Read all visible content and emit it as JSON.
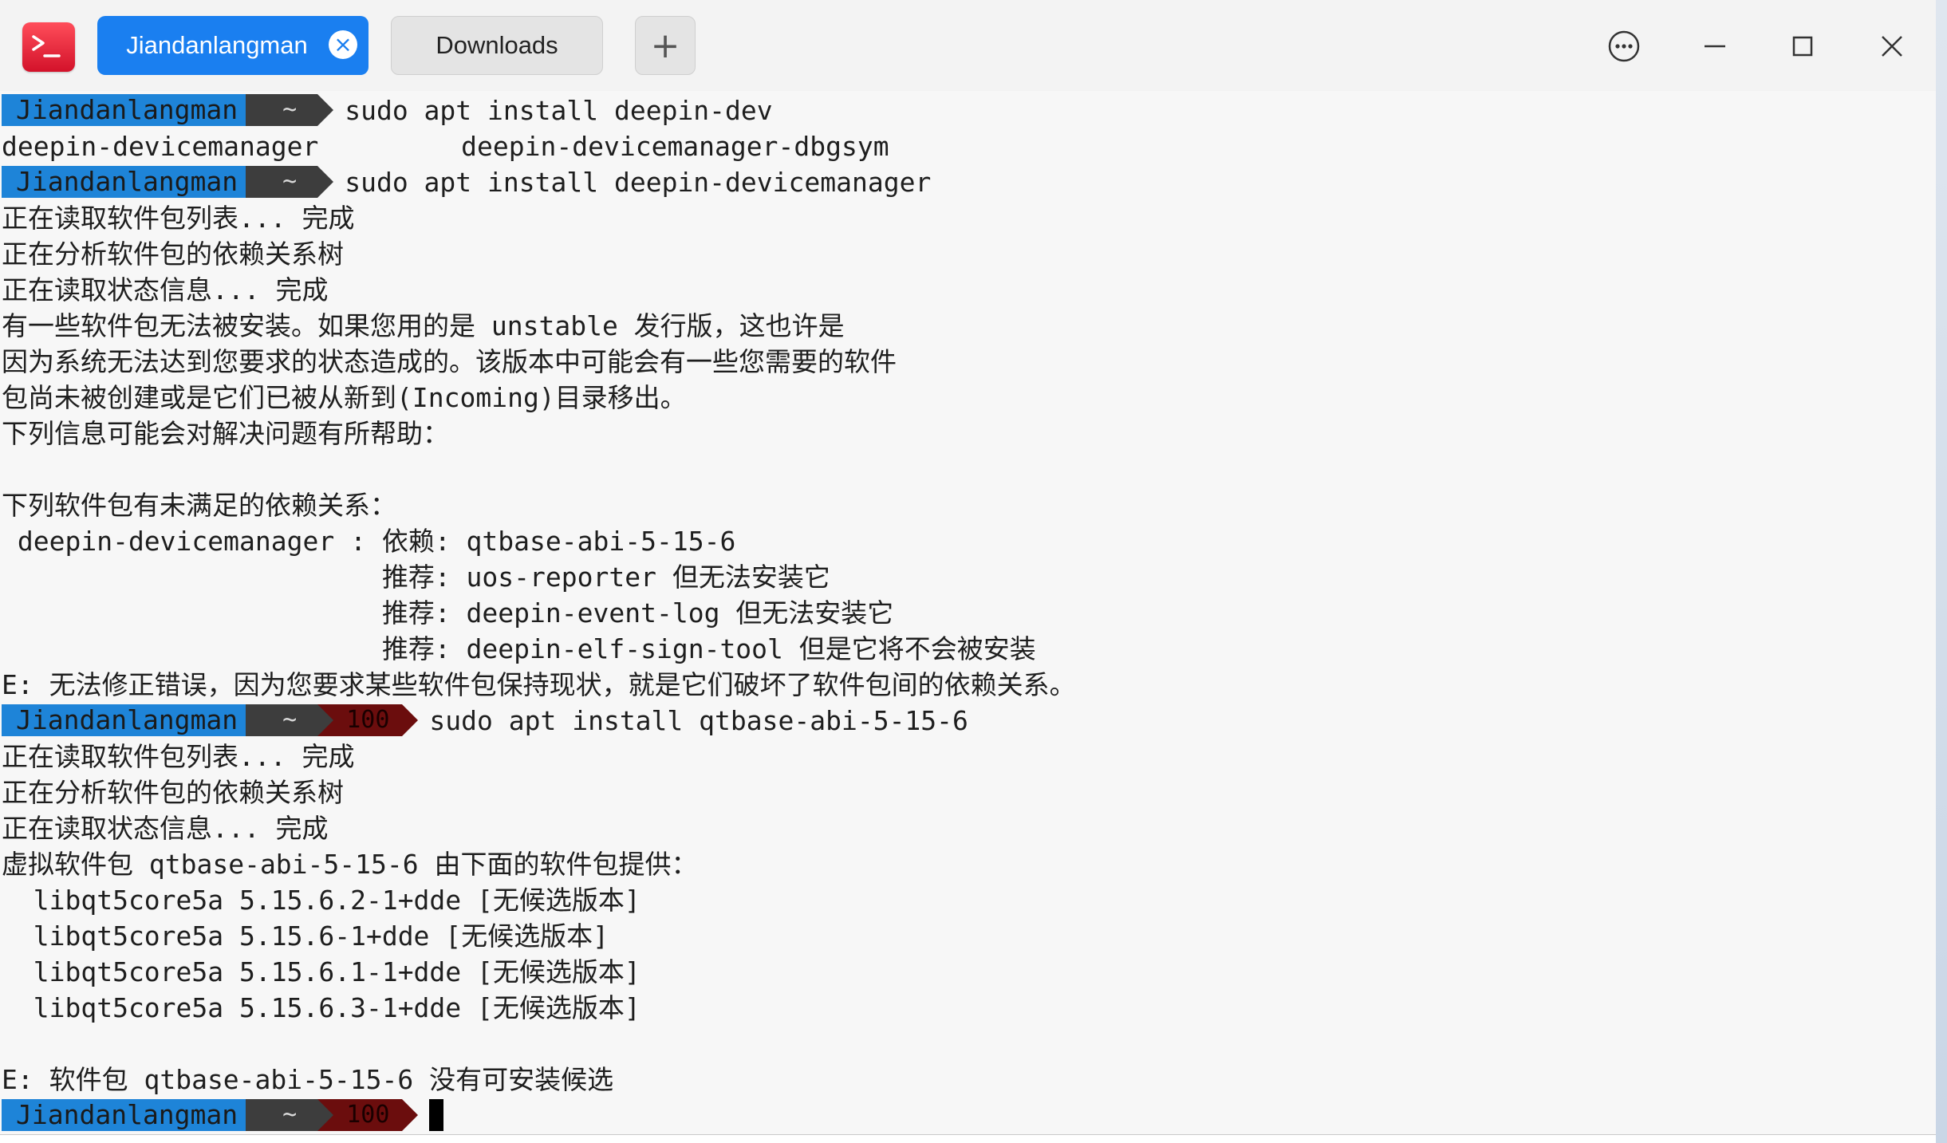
{
  "tabs": [
    {
      "label": "Jiandanlangman",
      "active": true
    },
    {
      "label": "Downloads",
      "active": false
    }
  ],
  "tab_add_label": "+",
  "tab_close_glyph": "×",
  "window_controls": [
    "more-icon",
    "minimize-icon",
    "maximize-icon",
    "close-icon"
  ],
  "colors": {
    "accent": "#1a7ff0",
    "prompt_user_bg": "#1e84d8",
    "prompt_home_bg": "#3d3d3d",
    "prompt_code_bg": "#6b0d0d",
    "app_icon": "#e8202f"
  },
  "prompt": {
    "user": "Jiandanlangman",
    "home": "~",
    "error_code": "100"
  },
  "lines": [
    {
      "type": "prompt",
      "cmd": "sudo apt install deepin-dev",
      "code": false
    },
    {
      "type": "text",
      "text": "deepin-devicemanager         deepin-devicemanager-dbgsym"
    },
    {
      "type": "prompt",
      "cmd": "sudo apt install deepin-devicemanager",
      "code": false
    },
    {
      "type": "text",
      "text": "正在读取软件包列表... 完成"
    },
    {
      "type": "text",
      "text": "正在分析软件包的依赖关系树"
    },
    {
      "type": "text",
      "text": "正在读取状态信息... 完成"
    },
    {
      "type": "text",
      "text": "有一些软件包无法被安装。如果您用的是 unstable 发行版，这也许是"
    },
    {
      "type": "text",
      "text": "因为系统无法达到您要求的状态造成的。该版本中可能会有一些您需要的软件"
    },
    {
      "type": "text",
      "text": "包尚未被创建或是它们已被从新到(Incoming)目录移出。"
    },
    {
      "type": "text",
      "text": "下列信息可能会对解决问题有所帮助："
    },
    {
      "type": "text",
      "text": ""
    },
    {
      "type": "text",
      "text": "下列软件包有未满足的依赖关系："
    },
    {
      "type": "text",
      "text": " deepin-devicemanager : 依赖: qtbase-abi-5-15-6"
    },
    {
      "type": "text",
      "text": "                        推荐: uos-reporter 但无法安装它"
    },
    {
      "type": "text",
      "text": "                        推荐: deepin-event-log 但无法安装它"
    },
    {
      "type": "text",
      "text": "                        推荐: deepin-elf-sign-tool 但是它将不会被安装"
    },
    {
      "type": "text",
      "text": "E: 无法修正错误，因为您要求某些软件包保持现状，就是它们破坏了软件包间的依赖关系。"
    },
    {
      "type": "prompt",
      "cmd": "sudo apt install qtbase-abi-5-15-6",
      "code": true
    },
    {
      "type": "text",
      "text": "正在读取软件包列表... 完成"
    },
    {
      "type": "text",
      "text": "正在分析软件包的依赖关系树"
    },
    {
      "type": "text",
      "text": "正在读取状态信息... 完成"
    },
    {
      "type": "text",
      "text": "虚拟软件包 qtbase-abi-5-15-6 由下面的软件包提供："
    },
    {
      "type": "text",
      "text": "  libqt5core5a 5.15.6.2-1+dde [无候选版本]"
    },
    {
      "type": "text",
      "text": "  libqt5core5a 5.15.6-1+dde [无候选版本]"
    },
    {
      "type": "text",
      "text": "  libqt5core5a 5.15.6.1-1+dde [无候选版本]"
    },
    {
      "type": "text",
      "text": "  libqt5core5a 5.15.6.3-1+dde [无候选版本]"
    },
    {
      "type": "text",
      "text": ""
    },
    {
      "type": "text",
      "text": "E: 软件包 qtbase-abi-5-15-6 没有可安装候选"
    },
    {
      "type": "prompt",
      "cmd": "",
      "code": true,
      "cursor": true
    }
  ]
}
